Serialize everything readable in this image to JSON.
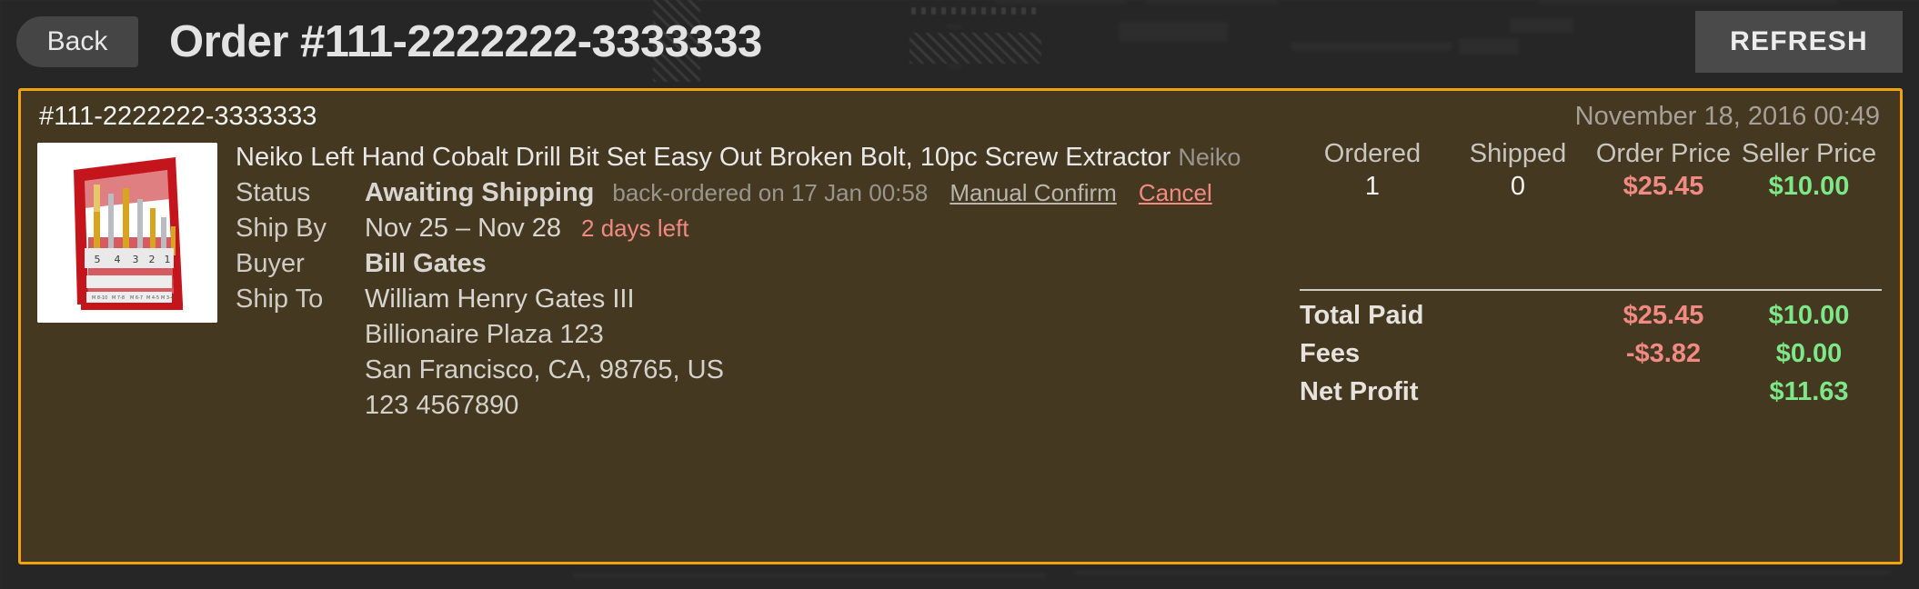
{
  "header": {
    "back_label": "Back",
    "title": "Order #111-2222222-3333333",
    "refresh_label": "REFRESH"
  },
  "card": {
    "order_id": "#111-2222222-3333333",
    "order_date": "November 18, 2016 00:49",
    "product": {
      "title": "Neiko Left Hand Cobalt Drill Bit Set Easy Out Broken Bolt, 10pc Screw Extractor",
      "brand": "Neiko"
    },
    "fields": {
      "status_label": "Status",
      "status_value": "Awaiting Shipping",
      "status_note": "back-ordered on 17 Jan 00:58",
      "manual_confirm_label": "Manual Confirm",
      "cancel_label": "Cancel",
      "ship_by_label": "Ship By",
      "ship_by_value": "Nov 25 – Nov 28",
      "ship_by_warning": "2 days left",
      "buyer_label": "Buyer",
      "buyer_value": "Bill Gates",
      "ship_to_label": "Ship To",
      "ship_to_lines": [
        "William Henry Gates III",
        "Billionaire Plaza 123",
        "San Francisco, CA, 98765, US",
        "123 4567890"
      ]
    },
    "price_table": {
      "headers": [
        "Ordered",
        "Shipped",
        "Order Price",
        "Seller Price"
      ],
      "values": [
        "1",
        "0",
        "$25.45",
        "$10.00"
      ]
    },
    "totals": [
      {
        "label": "Total Paid",
        "order": "$25.45",
        "seller": "$10.00"
      },
      {
        "label": "Fees",
        "order": "-$3.82",
        "seller": "$0.00"
      },
      {
        "label": "Net Profit",
        "order": "",
        "seller": "$11.63"
      }
    ]
  },
  "colors": {
    "accent_orange": "#f0a30a",
    "card_bg": "#443820",
    "page_bg": "#262626",
    "danger": "#f08a82",
    "positive": "#7ee787"
  }
}
